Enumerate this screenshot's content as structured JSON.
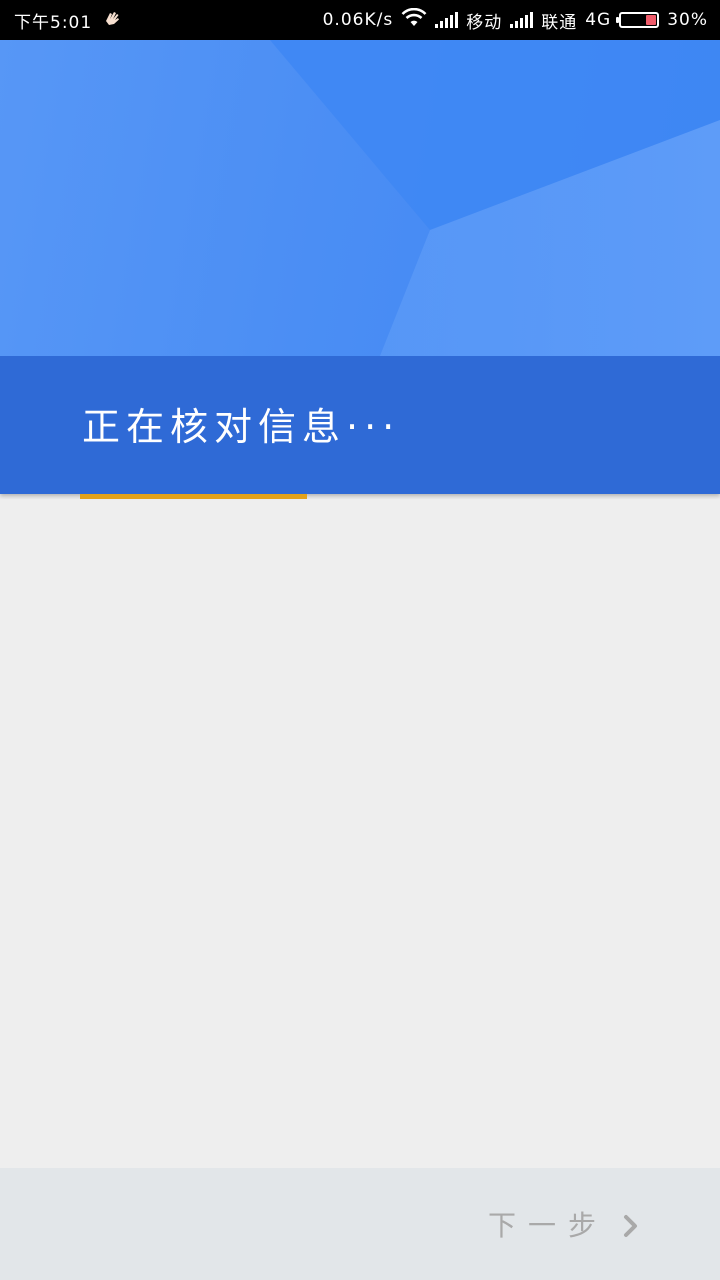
{
  "status_bar": {
    "time": "下午5:01",
    "notification_icon": "hand-icon",
    "net_speed": "0.06K/s",
    "wifi_icon": "wifi-icon",
    "carrier1": "移动",
    "carrier2": "联通",
    "network_type": "4G",
    "battery_percent": "30%",
    "battery_level": 0.3
  },
  "header": {
    "title": "正在核对信息···"
  },
  "progress": {
    "indicator_color": "#e3a21a"
  },
  "footer": {
    "next_label": "下一步",
    "next_icon": "chevron-right-icon"
  },
  "colors": {
    "header_blue": "#4a8ff5",
    "band_blue": "#2f6ad6",
    "background": "#eeeeee",
    "footer_bg": "#e2e6e9",
    "next_text": "#a9a9a9"
  }
}
